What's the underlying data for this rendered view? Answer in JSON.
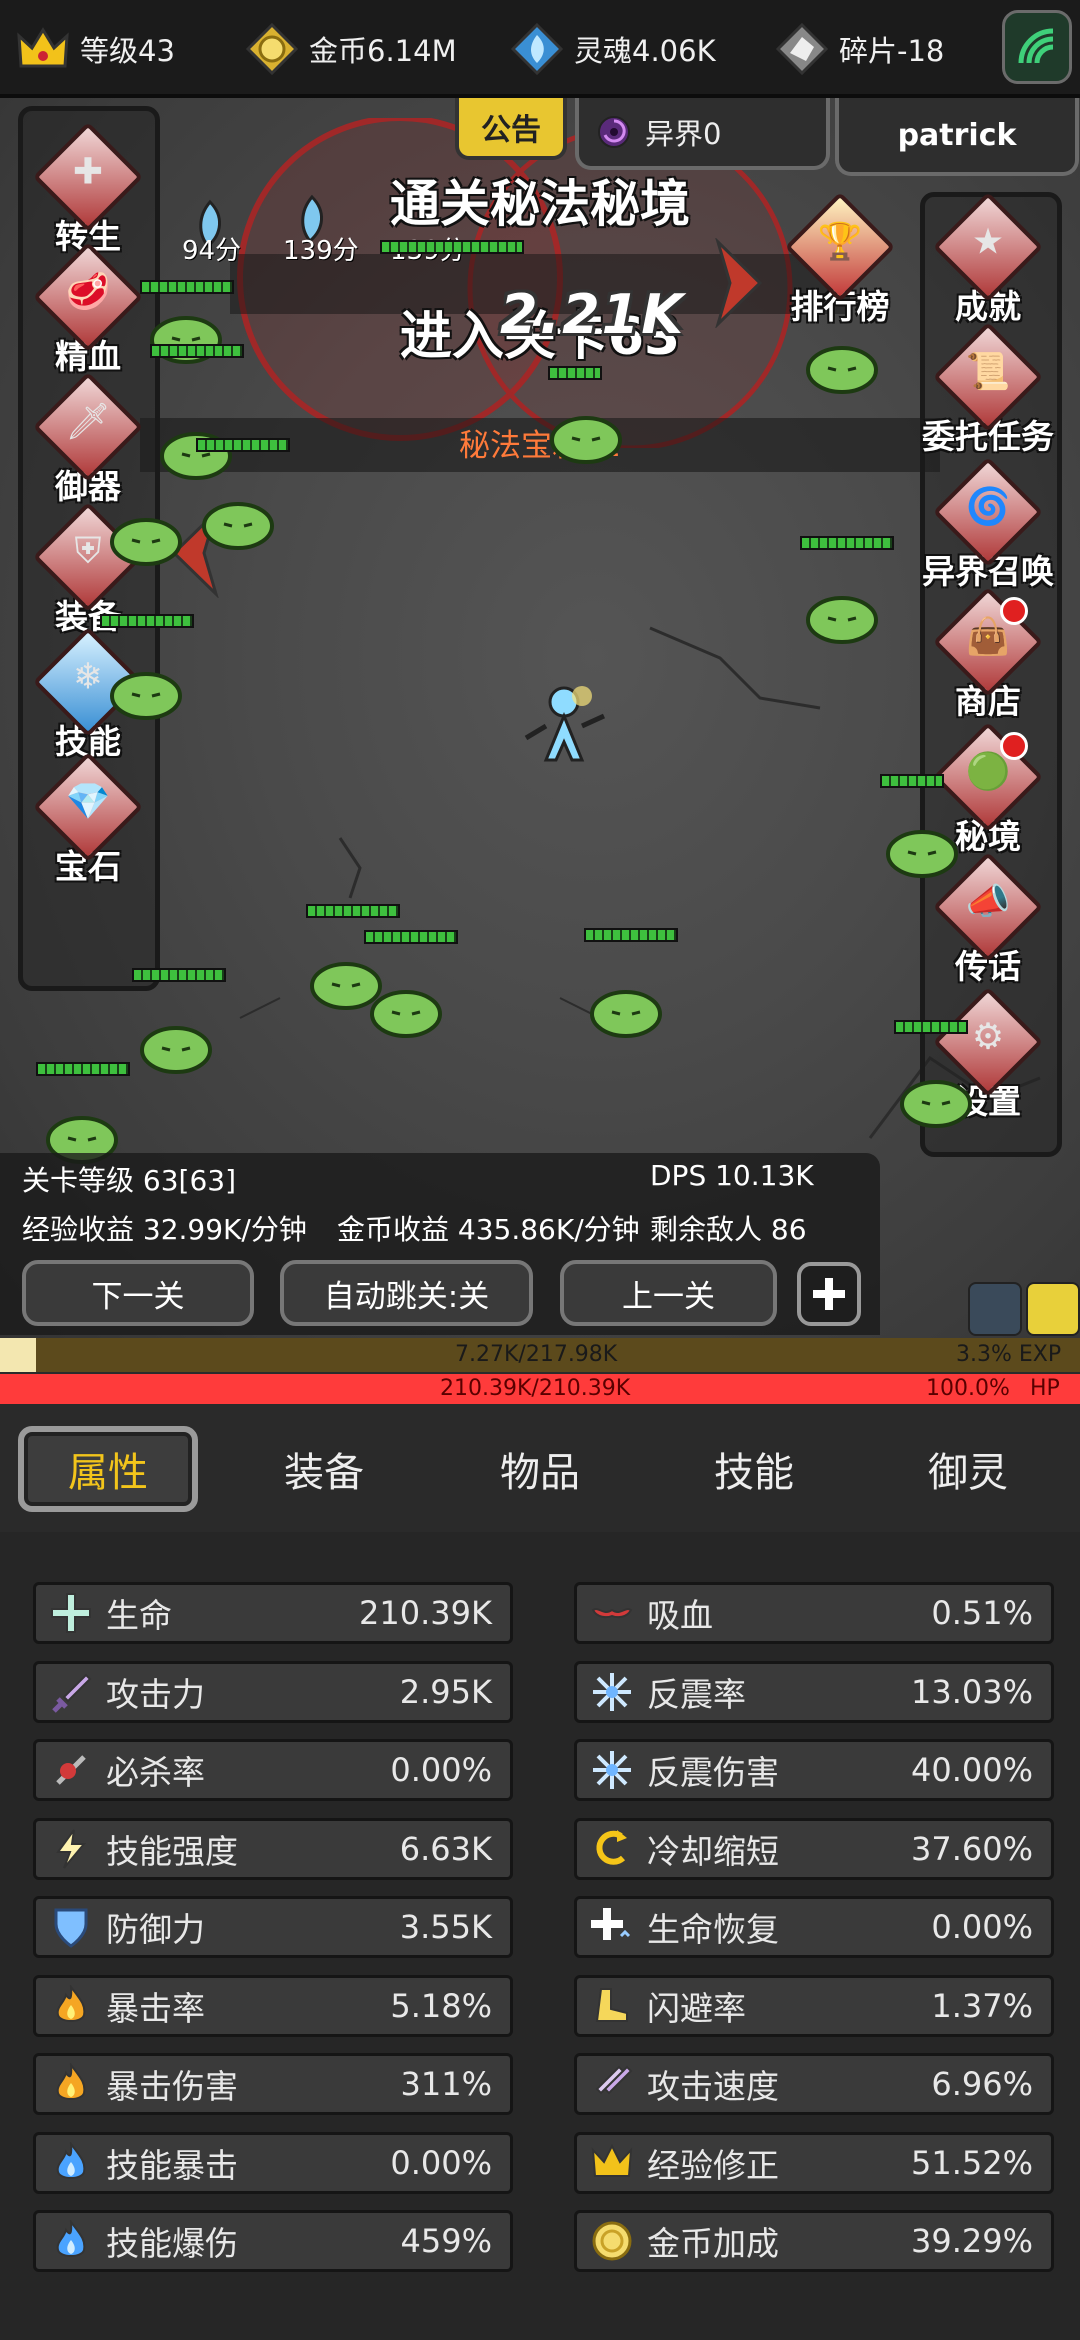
{
  "resources": [
    {
      "icon": "crown-icon",
      "label": "等级43"
    },
    {
      "icon": "coin-icon",
      "label": "金币6.14M"
    },
    {
      "icon": "soul-icon",
      "label": "灵魂4.06K"
    },
    {
      "icon": "shard-icon",
      "label": "碎片-18"
    }
  ],
  "top_tabs": {
    "announcement": "公告",
    "otherworld": "异界0",
    "user": "patrick"
  },
  "left_menu": [
    "转生",
    "精血",
    "御器",
    "装备",
    "技能",
    "宝石"
  ],
  "right_menu": [
    "排行榜",
    "成就",
    "委托任务",
    "异界召唤",
    "商店",
    "秘境",
    "传话",
    "设置"
  ],
  "banner": {
    "title": "通关秘法秘境",
    "enter": "进入关卡63"
  },
  "drops": [
    "94分",
    "139分",
    "139分"
  ],
  "damage_number": "2.21K",
  "chest": "秘法宝箱x2",
  "stage": {
    "level": "关卡等级 63[63]",
    "dps": "DPS 10.13K",
    "exp_income": "经验收益 32.99K/分钟",
    "gold_income": "金币收益 435.86K/分钟",
    "enemies_left": "剩余敌人 86"
  },
  "nav": {
    "next": "下一关",
    "auto": "自动跳关:关",
    "prev": "上一关"
  },
  "exp": {
    "text": "7.27K/217.98K",
    "percent": "3.3% EXP",
    "fill": 0.033
  },
  "hp": {
    "text": "210.39K/210.39K",
    "percent": "100.0%",
    "label": "HP"
  },
  "tabs": [
    "属性",
    "装备",
    "物品",
    "技能",
    "御灵"
  ],
  "attrs_left": [
    {
      "icon": "health-cross-icon",
      "name": "生命",
      "value": "210.39K"
    },
    {
      "icon": "sword-icon",
      "name": "攻击力",
      "value": "2.95K"
    },
    {
      "icon": "critical-hit-icon",
      "name": "必杀率",
      "value": "0.00%"
    },
    {
      "icon": "lightning-icon",
      "name": "技能强度",
      "value": "6.63K"
    },
    {
      "icon": "shield-icon",
      "name": "防御力",
      "value": "3.55K"
    },
    {
      "icon": "fire-icon",
      "name": "暴击率",
      "value": "5.18%"
    },
    {
      "icon": "fire-icon",
      "name": "暴击伤害",
      "value": "311%"
    },
    {
      "icon": "blue-fire-icon",
      "name": "技能暴击",
      "value": "0.00%"
    },
    {
      "icon": "blue-fire-icon",
      "name": "技能爆伤",
      "value": "459%"
    }
  ],
  "attrs_right": [
    {
      "icon": "bat-icon",
      "name": "吸血",
      "value": "0.51%"
    },
    {
      "icon": "ice-burst-icon",
      "name": "反震率",
      "value": "13.03%"
    },
    {
      "icon": "ice-burst-icon",
      "name": "反震伤害",
      "value": "40.00%"
    },
    {
      "icon": "cooldown-icon",
      "name": "冷却缩短",
      "value": "37.60%"
    },
    {
      "icon": "regen-icon",
      "name": "生命恢复",
      "value": "0.00%"
    },
    {
      "icon": "boot-icon",
      "name": "闪避率",
      "value": "1.37%"
    },
    {
      "icon": "attack-speed-icon",
      "name": "攻击速度",
      "value": "6.96%"
    },
    {
      "icon": "crown-icon",
      "name": "经验修正",
      "value": "51.52%"
    },
    {
      "icon": "coin-icon",
      "name": "金币加成",
      "value": "39.29%"
    }
  ]
}
